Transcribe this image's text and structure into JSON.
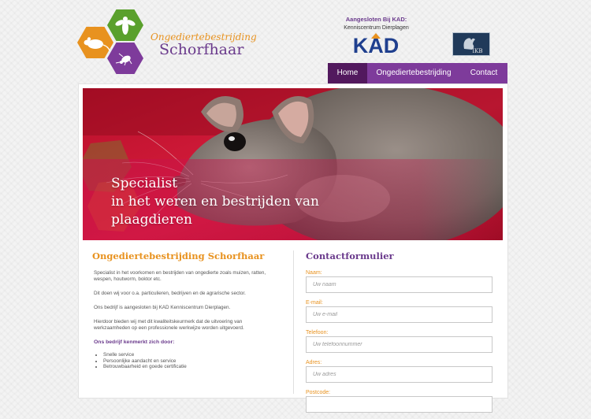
{
  "logo": {
    "title_line1": "Ongediertebestrijding",
    "title_line2": "Schorfhaar",
    "hex_icons": [
      "rat-icon",
      "bee-icon",
      "cockroach-icon"
    ],
    "colors": {
      "orange": "#e8921f",
      "green": "#5aa02c",
      "purple": "#7e3b9b"
    }
  },
  "affiliation": {
    "label": "Aangesloten Bij KAD:",
    "center": "Kenniscentrum Dierplagen",
    "kad_logo_text": "KAD",
    "ikb_logo_text": "IKB"
  },
  "nav": {
    "items": [
      {
        "label": "Home",
        "active": true
      },
      {
        "label": "Ongediertebestrijding",
        "active": false
      },
      {
        "label": "Contact",
        "active": false
      }
    ]
  },
  "hero": {
    "line1": "Specialist",
    "line2": "in het weren en bestrijden van",
    "line3": "plaagdieren"
  },
  "intro": {
    "heading": "Ongediertebestrijding Schorfhaar",
    "paragraphs": [
      "Specialist in het voorkomen en bestrijden van ongedierte zoals muizen, ratten, wespen, houtworm, boktor etc.",
      "Dit doen wij voor o.a. particulieren, bedrijven en de agrarische sector.",
      "Ons bedrijf is aangesloten bij KAD Kenniscentrum Dierplagen.",
      "Hierdoor bieden wij met dit kwaliteitskeurmerk dat de uitvoering van werkzaamheden op een professionele werkwijze worden uitgevoerd."
    ],
    "features_heading": "Ons bedrijf kenmerkt zich door:",
    "features": [
      "Snelle service",
      "Persoonlijke aandacht en service",
      "Betrouwbaarheid en goede certificatie"
    ]
  },
  "contact_form": {
    "title": "Contactformulier",
    "fields": [
      {
        "label": "Naam:",
        "placeholder": "Uw naam",
        "value": ""
      },
      {
        "label": "E-mail:",
        "placeholder": "Uw e-mail",
        "value": ""
      },
      {
        "label": "Telefoon:",
        "placeholder": "Uw telefoonnummer",
        "value": ""
      },
      {
        "label": "Adres:",
        "placeholder": "Uw adres",
        "value": ""
      },
      {
        "label": "Postcode:",
        "placeholder": "",
        "value": ""
      }
    ]
  }
}
